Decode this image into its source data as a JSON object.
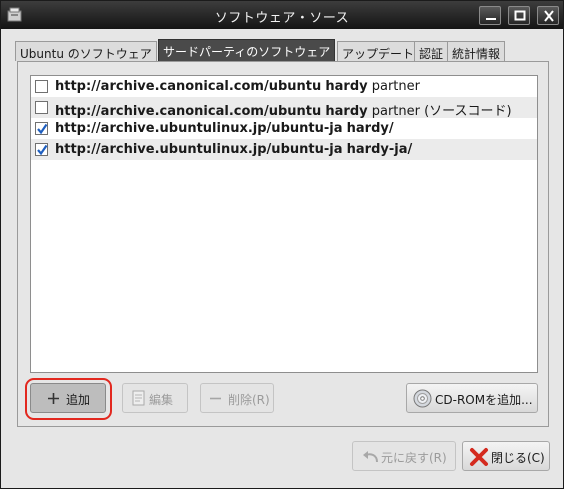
{
  "window": {
    "title": "ソフトウェア・ソース"
  },
  "tabs": [
    {
      "label": "Ubuntu のソフトウェア",
      "active": false
    },
    {
      "label": "サードパーティのソフトウェア",
      "active": true
    },
    {
      "label": "アップデート",
      "active": false
    },
    {
      "label": "認証",
      "active": false
    },
    {
      "label": "統計情報",
      "active": false
    }
  ],
  "sources": [
    {
      "url": "http://archive.canonical.com/ubuntu",
      "dist": "hardy",
      "component": "partner",
      "checked": false
    },
    {
      "url": "http://archive.canonical.com/ubuntu",
      "dist": "hardy",
      "component": "partner (ソースコード)",
      "checked": false
    },
    {
      "url": "http://archive.ubuntulinux.jp/ubuntu-ja",
      "dist": "hardy/",
      "component": "",
      "checked": true
    },
    {
      "url": "http://archive.ubuntulinux.jp/ubuntu-ja",
      "dist": "hardy-ja/",
      "component": "",
      "checked": true
    }
  ],
  "buttons": {
    "add": "追加",
    "edit": "編集",
    "delete": "削除(R)",
    "cdrom": "CD-ROMを追加...",
    "revert": "元に戻す(R)",
    "close": "閉じる(C)"
  },
  "colors": {
    "highlight": "#e2281f",
    "check": "#1f5fbf",
    "close_icon": "#d42a1e"
  }
}
